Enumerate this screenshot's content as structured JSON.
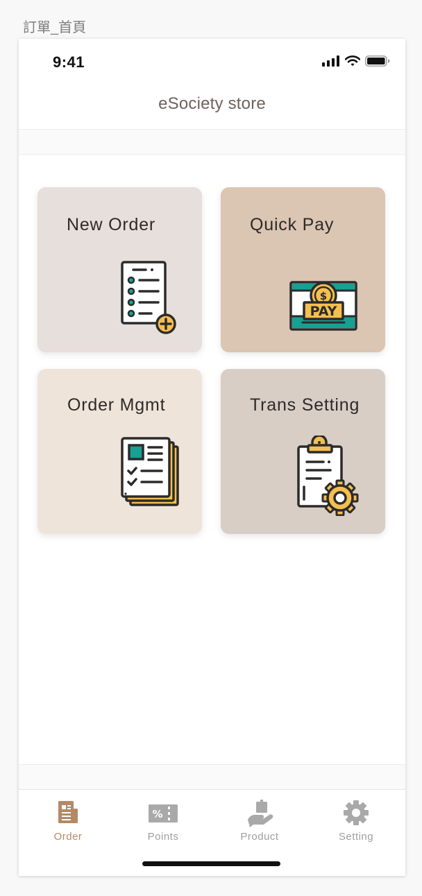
{
  "frame_label": "訂單_首頁",
  "status_bar": {
    "time": "9:41"
  },
  "header": {
    "title": "eSociety store"
  },
  "tiles": [
    {
      "label": "New Order",
      "icon": "new-order-icon",
      "bg": "#e7dfdb"
    },
    {
      "label": "Quick Pay",
      "icon": "quick-pay-icon",
      "bg": "#dbc5b3",
      "icon_text": "PAY"
    },
    {
      "label": "Order Mgmt",
      "icon": "order-mgmt-icon",
      "bg": "#efe4da"
    },
    {
      "label": "Trans Setting",
      "icon": "trans-setting-icon",
      "bg": "#d8cec6"
    }
  ],
  "tab_bar": {
    "items": [
      {
        "label": "Order",
        "icon": "order-tab-icon",
        "active": true
      },
      {
        "label": "Points",
        "icon": "points-tab-icon",
        "active": false
      },
      {
        "label": "Product",
        "icon": "product-tab-icon",
        "active": false
      },
      {
        "label": "Setting",
        "icon": "setting-tab-icon",
        "active": false
      }
    ]
  },
  "colors": {
    "accent": "#b38a66",
    "inactive_tab": "#9e9e9e",
    "teal": "#16a192",
    "gold": "#f5bf4f",
    "icon_outline": "#2b2b2b"
  }
}
